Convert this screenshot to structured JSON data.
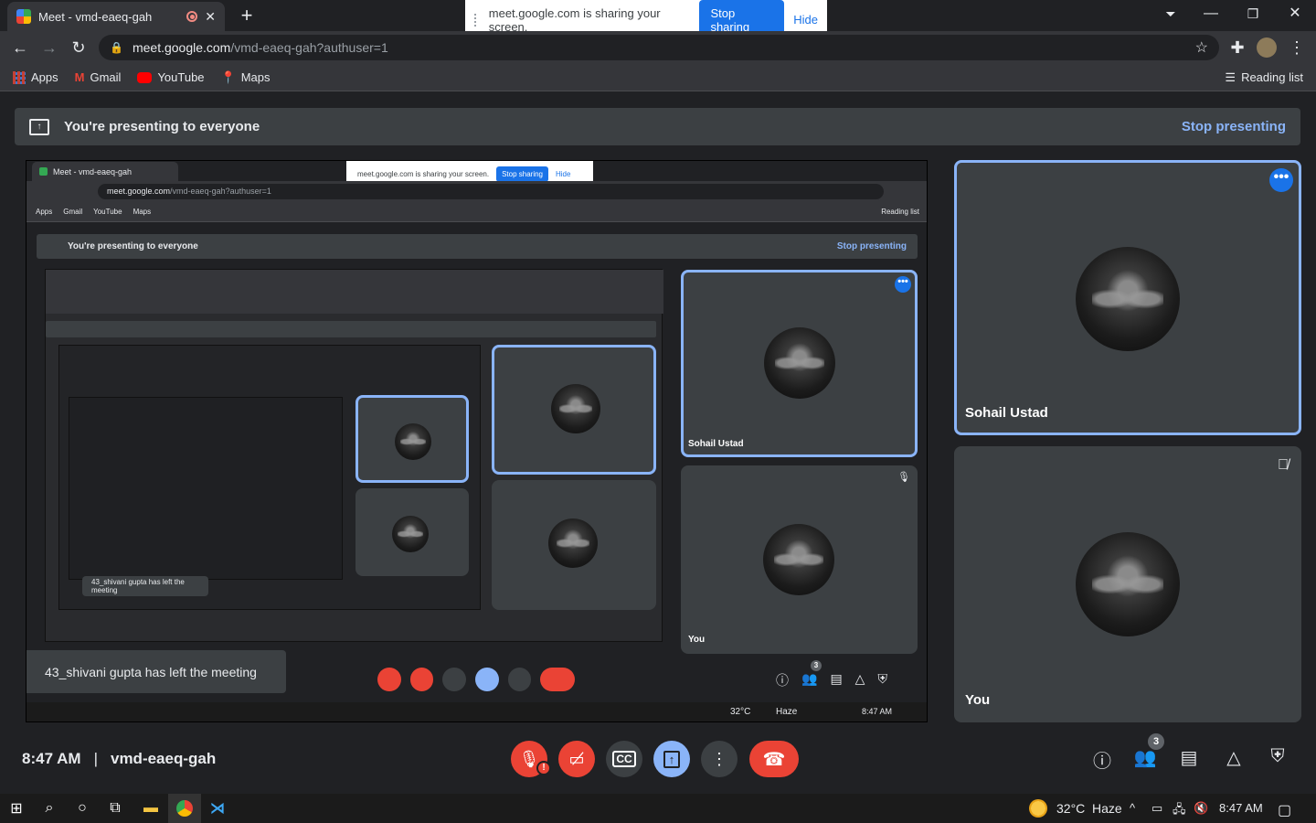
{
  "browser": {
    "tab_title": "Meet - vmd-eaeq-gah",
    "new_tab": "+",
    "url_host": "meet.google.com",
    "url_path": "/vmd-eaeq-gah?authuser=1",
    "bookmarks": [
      "Apps",
      "Gmail",
      "YouTube",
      "Maps"
    ],
    "reading_list": "Reading list"
  },
  "share_bar": {
    "message": "meet.google.com is sharing your screen.",
    "stop_label": "Stop sharing",
    "hide_label": "Hide"
  },
  "meet": {
    "banner_text": "You're presenting to everyone",
    "stop_presenting": "Stop presenting",
    "time": "8:47 AM",
    "separator": "|",
    "meeting_code": "vmd-eaeq-gah",
    "participants_count": "3",
    "tiles": [
      {
        "name": "Sohail Ustad",
        "active": true
      },
      {
        "name": "You",
        "active": false
      }
    ],
    "snackbar": "43_shivani gupta has left the meeting"
  },
  "nested_share": {
    "tab_title": "Meet - vmd-eaeq-gah",
    "share_message": "meet.google.com is sharing your screen.",
    "stop_label": "Stop sharing",
    "hide_label": "Hide",
    "url_host": "meet.google.com",
    "url_path": "/vmd-eaeq-gah?authuser=1",
    "bookmarks": [
      "Apps",
      "Gmail",
      "YouTube",
      "Maps"
    ],
    "reading_list": "Reading list",
    "banner_text": "You're presenting to everyone",
    "stop_presenting": "Stop presenting",
    "tile1_name": "Sohail Ustad",
    "tile2_name": "You",
    "snackbar": "43_shivani gupta has left the meeting",
    "snackbar_inner": "43_shivani gupta has left the meeting",
    "participants_count": "3",
    "weather_temp": "32°C",
    "weather_desc": "Haze",
    "clock": "8:47 AM"
  },
  "taskbar": {
    "weather_temp": "32°C",
    "weather_desc": "Haze",
    "clock": "8:47 AM"
  }
}
